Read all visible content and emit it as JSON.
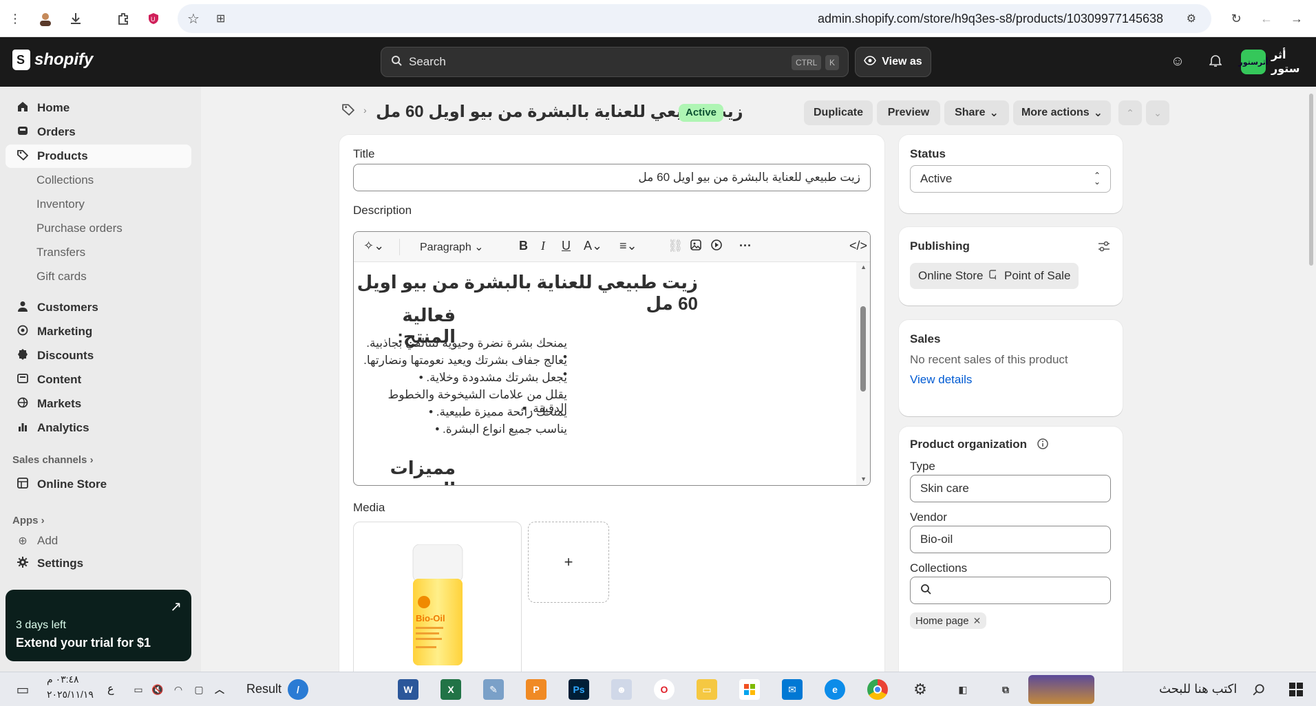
{
  "browser": {
    "url": "admin.shopify.com/store/h9q3es-s8/products/10309977145638"
  },
  "topbar": {
    "brand": "shopify",
    "search_label": "Search",
    "kbd_ctrl": "CTRL",
    "kbd_k": "K",
    "view_as": "View as",
    "store_name": "أثر ستور",
    "store_avatar_text": "أثرستور"
  },
  "sidebar": {
    "items": [
      {
        "label": "Home",
        "icon": "home-icon"
      },
      {
        "label": "Orders",
        "icon": "inbox-icon"
      },
      {
        "label": "Products",
        "icon": "tag-icon"
      },
      {
        "label": "Customers",
        "icon": "person-icon"
      },
      {
        "label": "Marketing",
        "icon": "target-icon"
      },
      {
        "label": "Discounts",
        "icon": "discount-icon"
      },
      {
        "label": "Content",
        "icon": "content-icon"
      },
      {
        "label": "Markets",
        "icon": "globe-icon"
      },
      {
        "label": "Analytics",
        "icon": "bar-chart-icon"
      },
      {
        "label": "Online Store",
        "icon": "store-icon"
      },
      {
        "label": "Add",
        "icon": "plus-circle-icon"
      },
      {
        "label": "Settings",
        "icon": "gear-icon"
      }
    ],
    "sub_items": [
      "Collections",
      "Inventory",
      "Purchase orders",
      "Transfers",
      "Gift cards"
    ],
    "sales_channels": "Sales channels",
    "apps": "Apps",
    "trial_days": "3 days left",
    "trial_cta": "Extend your trial for $1"
  },
  "header": {
    "title": "زيت طبيعي للعناية بالبشرة من بيو اويل 60 مل",
    "status_badge": "Active",
    "duplicate": "Duplicate",
    "preview": "Preview",
    "share": "Share",
    "more_actions": "More actions"
  },
  "main": {
    "title_label": "Title",
    "title_value": "زيت طبيعي للعناية بالبشرة من بيو اويل 60 مل",
    "description_label": "Description",
    "paragraph": "Paragraph",
    "desc_h1": "زيت طبيعي للعناية بالبشرة من بيو اويل 60 مل",
    "desc_h2a": "فعالية المنتج:",
    "desc_list": [
      "يمنحك بشرة نضرة وحيوية لتتالقي بجاذبية.",
      "يعالج جفاف بشرتك ويعيد نعومتها ونضارتها.",
      "يجعل بشرتك مشدودة وخلاية.",
      "يقلل من علامات الشيخوخة والخطوط الدقيقة.",
      "يمنحك رائحة مميزة طبيعية.",
      "يناسب جميع انواع البشرة."
    ],
    "desc_h2b": "مميزات المنتج:",
    "media_label": "Media",
    "bottle_brand": "Bio-Oil"
  },
  "right": {
    "status_label": "Status",
    "status_value": "Active",
    "publishing_label": "Publishing",
    "channel_online": "Online Store",
    "channel_pos": "Point of Sale",
    "sales_label": "Sales",
    "sales_text": "No recent sales of this product",
    "view_details": "View details",
    "org_label": "Product organization",
    "type_label": "Type",
    "type_value": "Skin care",
    "vendor_label": "Vendor",
    "vendor_value": "Bio-oil",
    "collections_label": "Collections",
    "collection_tag": "Home page"
  },
  "taskbar": {
    "time": "٠٣:٤٨ م",
    "date": "٢٠٢٥/١١/١٩",
    "lang": "ع",
    "result": "Result",
    "search_text": "اكتب هنا للبحث"
  }
}
